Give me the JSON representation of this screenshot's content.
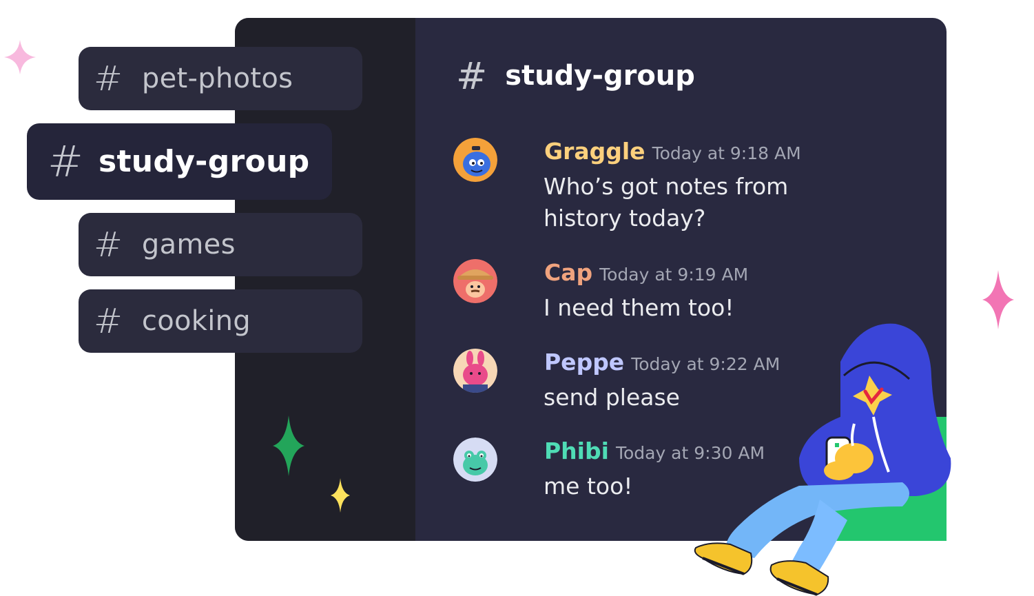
{
  "channels": [
    {
      "label": "pet-photos",
      "hash": "#"
    },
    {
      "label": "study-group",
      "hash": "#"
    },
    {
      "label": "games",
      "hash": "#"
    },
    {
      "label": "cooking",
      "hash": "#"
    }
  ],
  "header": {
    "hash": "#",
    "title": "study-group"
  },
  "messages": [
    {
      "author": "Graggle",
      "time": "Today at 9:18 AM",
      "text": "Who’s got notes from history today?",
      "color": "#fcd07d",
      "avatar": "blue-genie-avatar"
    },
    {
      "author": "Cap",
      "time": "Today at 9:19 AM",
      "text": "I need them too!",
      "color": "#f0a37e",
      "avatar": "straw-hat-avatar"
    },
    {
      "author": "Peppe",
      "time": "Today at 9:22 AM",
      "text": "send please",
      "color": "#bfc7ff",
      "avatar": "pink-bunny-avatar"
    },
    {
      "author": "Phibi",
      "time": "Today at 9:30 AM",
      "text": "me too!",
      "color": "#4fdcb5",
      "avatar": "green-frog-avatar"
    }
  ],
  "colors": {
    "window_bg": "#292940",
    "sidebar_bg": "#202029",
    "channel_bg": "#2b2b3d",
    "sparkle_pink": "#f275b4",
    "sparkle_green": "#23a55a",
    "sparkle_yellow": "#fde25d"
  }
}
